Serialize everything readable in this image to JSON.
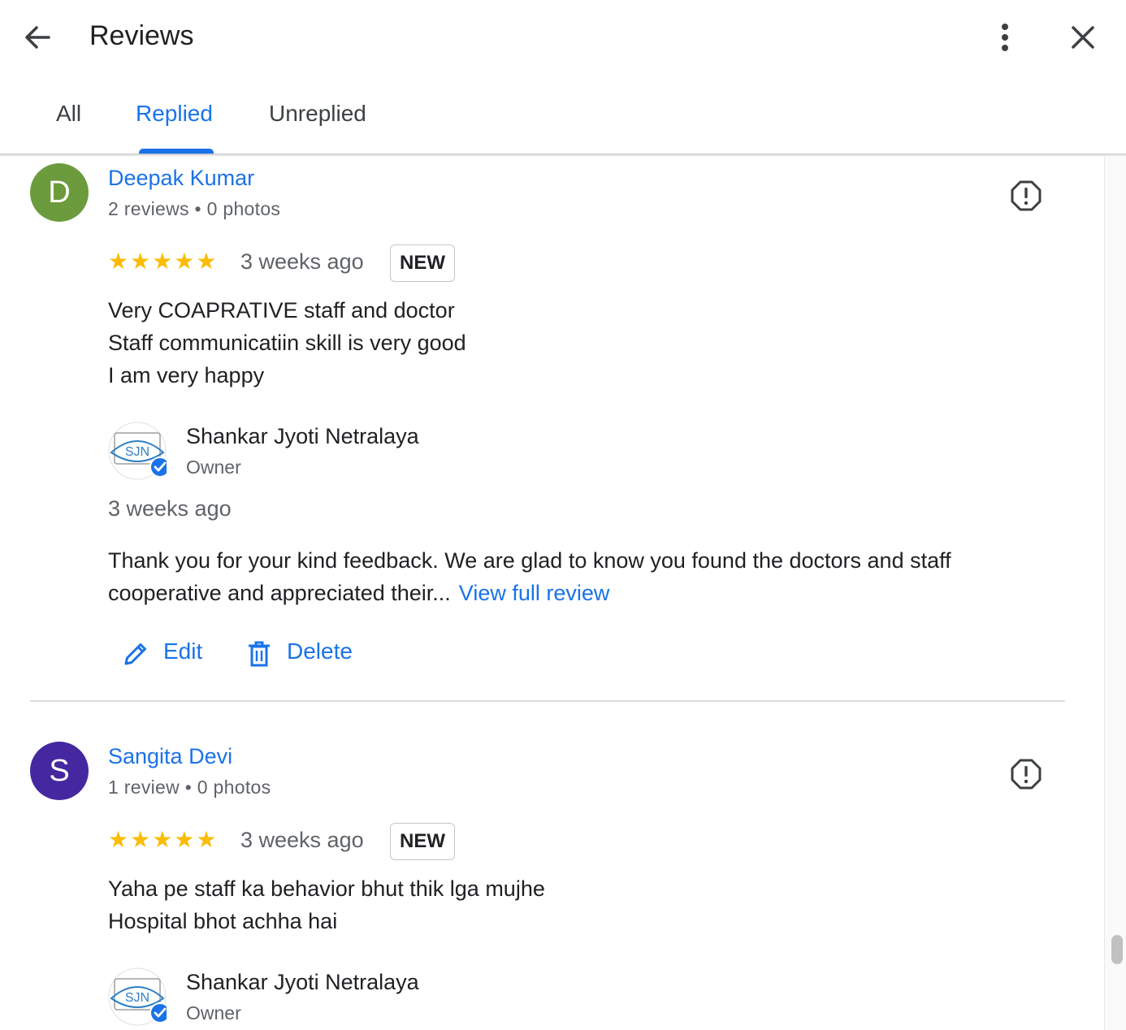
{
  "header": {
    "title": "Reviews",
    "tabs": [
      {
        "label": "All",
        "active": false
      },
      {
        "label": "Replied",
        "active": true
      },
      {
        "label": "Unreplied",
        "active": false
      }
    ]
  },
  "colors": {
    "accent": "#1a73e8",
    "star": "#fbbc04",
    "avatar_d": "#6c9b3d",
    "avatar_s": "#4527a0"
  },
  "reviews": [
    {
      "avatar_letter": "D",
      "name": "Deepak Kumar",
      "meta": "2 reviews • 0 photos",
      "stars": "★★★★★",
      "rating": 5,
      "time": "3 weeks ago",
      "badge": "NEW",
      "lines": [
        "Very COAPRATIVE staff and doctor",
        "Staff communicatiin skill is very good",
        "I am very happy"
      ],
      "reply": {
        "owner_name": "Shankar Jyoti Netralaya",
        "owner_role": "Owner",
        "time": "3 weeks ago",
        "text": "Thank you for your kind feedback. We are glad to know you found the doctors and staff cooperative and appreciated their...",
        "view_full": "View full review"
      },
      "actions": {
        "edit": "Edit",
        "delete": "Delete"
      }
    },
    {
      "avatar_letter": "S",
      "name": "Sangita Devi",
      "meta": "1 review • 0 photos",
      "stars": "★★★★★",
      "rating": 5,
      "time": "3 weeks ago",
      "badge": "NEW",
      "lines": [
        "Yaha pe staff ka behavior bhut thik lga mujhe",
        "Hospital bhot achha hai"
      ],
      "reply": {
        "owner_name": "Shankar Jyoti Netralaya",
        "owner_role": "Owner"
      }
    }
  ],
  "logo_text": "SJN"
}
